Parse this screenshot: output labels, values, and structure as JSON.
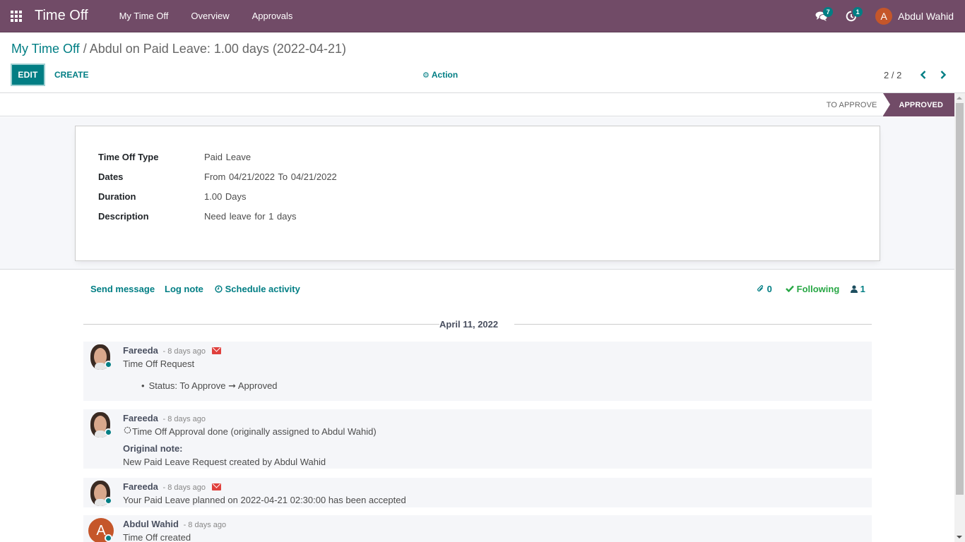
{
  "navbar": {
    "app_title": "Time Off",
    "menu": [
      "My Time Off",
      "Overview",
      "Approvals"
    ],
    "messages_count": "7",
    "activities_count": "1",
    "user_initial": "A",
    "user_name": "Abdul Wahid",
    "bg_color": "#714b67"
  },
  "control_panel": {
    "breadcrumb_parent": "My Time Off",
    "breadcrumb_separator": " / ",
    "breadcrumb_current": "Abdul on Paid Leave: 1.00 days (2022-04-21)",
    "edit_label": "EDIT",
    "create_label": "CREATE",
    "action_label": "Action",
    "pager_value": "2 / 2"
  },
  "statusbar": {
    "steps": [
      "TO APPROVE",
      "APPROVED"
    ],
    "current": "APPROVED"
  },
  "form": {
    "fields": [
      {
        "label": "Time Off Type",
        "value": "Paid Leave"
      },
      {
        "label": "Dates",
        "value": "From 04/21/2022 To 04/21/2022"
      },
      {
        "label": "Duration",
        "value": "1.00 Days"
      },
      {
        "label": "Description",
        "value": "Need leave for 1 days"
      }
    ]
  },
  "chatter": {
    "send_message": "Send message",
    "log_note": "Log note",
    "schedule_activity": "Schedule activity",
    "attachments_count": "0",
    "following_label": "Following",
    "followers_count": "1",
    "date_separator": "April 11, 2022",
    "messages": [
      {
        "author": "Fareeda",
        "date": "- 8 days ago",
        "has_envelope": true,
        "body": "Time Off Request",
        "tracking": "Status: To Approve",
        "tracking_arrow": "➞",
        "tracking_new": "Approved"
      },
      {
        "author": "Fareeda",
        "date": "- 8 days ago",
        "has_envelope": false,
        "body": "Time Off Approval done (originally assigned to Abdul Wahid)",
        "note_label": "Original note:",
        "note": "New Paid Leave Request created by Abdul Wahid"
      },
      {
        "author": "Fareeda",
        "date": "- 8 days ago",
        "has_envelope": true,
        "body": "Your Paid Leave planned on 2022-04-21 02:30:00 has been accepted"
      },
      {
        "author": "Abdul Wahid",
        "author_initial": "A",
        "date": "- 8 days ago",
        "has_envelope": false,
        "body": "Time Off created"
      }
    ]
  }
}
